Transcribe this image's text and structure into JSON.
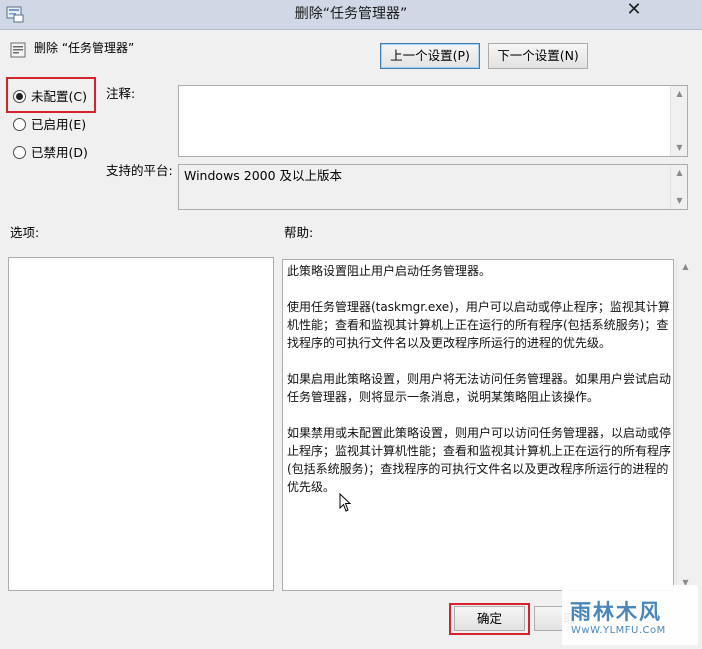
{
  "window": {
    "title": "删除“任务管理器”",
    "close_glyph": "✕"
  },
  "header": {
    "policy_title": "删除 “任务管理器”",
    "prev_button": "上一个设置(P)",
    "next_button": "下一个设置(N)"
  },
  "state": {
    "options": [
      {
        "label": "未配置(C)",
        "checked": true
      },
      {
        "label": "已启用(E)",
        "checked": false
      },
      {
        "label": "已禁用(D)",
        "checked": false
      }
    ]
  },
  "comment": {
    "label": "注释:",
    "value": ""
  },
  "platform": {
    "label": "支持的平台:",
    "value": "Windows 2000 及以上版本"
  },
  "options_panel": {
    "label": "选项:"
  },
  "help_panel": {
    "label": "帮助:",
    "paragraphs": [
      "此策略设置阻止用户启动任务管理器。",
      "使用任务管理器(taskmgr.exe)，用户可以启动或停止程序；监视其计算机性能；查看和监视其计算机上正在运行的所有程序(包括系统服务)；查找程序的可执行文件名以及更改程序所运行的进程的优先级。",
      "如果启用此策略设置，则用户将无法访问任务管理器。如果用户尝试启动任务管理器，则将显示一条消息，说明某策略阻止该操作。",
      "如果禁用或未配置此策略设置，则用户可以访问任务管理器，以启动或停止程序；监视其计算机性能；查看和监视其计算机上正在运行的所有程序(包括系统服务)；查找程序的可执行文件名以及更改程序所运行的进程的优先级。"
    ]
  },
  "footer": {
    "ok_button": "确定",
    "cancel_button": "取"
  },
  "watermark": {
    "logo": "雨林木风",
    "url": "WwW.YLMFU.CoM"
  },
  "colors": {
    "highlight": "#d6222c",
    "titlebar": "#cfd8e4",
    "watermark": "#4a87b8"
  }
}
